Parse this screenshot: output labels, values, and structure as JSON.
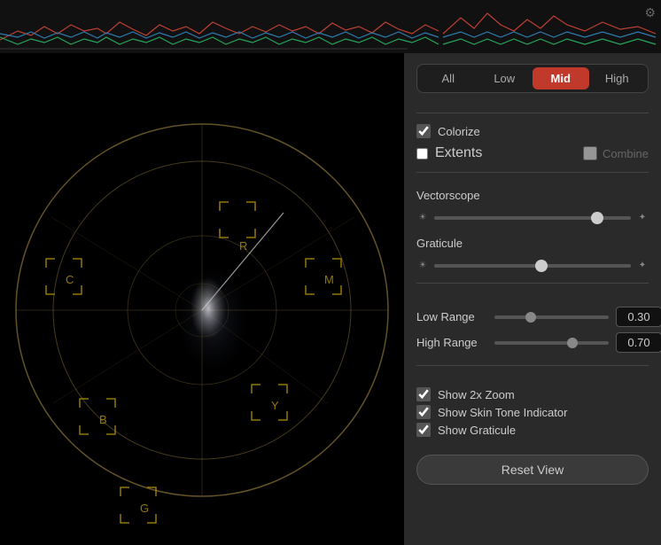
{
  "waveform": {
    "label": "Waveform Bar"
  },
  "tabs": {
    "items": [
      {
        "label": "All",
        "id": "all",
        "active": false
      },
      {
        "label": "Low",
        "id": "low",
        "active": false
      },
      {
        "label": "Mid",
        "id": "mid",
        "active": true
      },
      {
        "label": "High",
        "id": "high",
        "active": false
      }
    ]
  },
  "checkboxes": {
    "colorize": {
      "label": "Colorize",
      "checked": true
    },
    "extents": {
      "label": "Extents",
      "checked": false
    },
    "combine": {
      "label": "Combine",
      "checked": false
    }
  },
  "sliders": {
    "vectorscope_label": "Vectorscope",
    "graticule_label": "Graticule",
    "vectorscope_value": 85,
    "graticule_value": 55
  },
  "ranges": {
    "low_range": {
      "label": "Low Range",
      "value": "0.30",
      "slider_val": 30
    },
    "high_range": {
      "label": "High Range",
      "value": "0.70",
      "slider_val": 70
    }
  },
  "options": {
    "show_2x_zoom": {
      "label": "Show 2x Zoom",
      "checked": true
    },
    "show_skin_tone": {
      "label": "Show Skin Tone Indicator",
      "checked": true
    },
    "show_graticule": {
      "label": "Show Graticule",
      "checked": true
    }
  },
  "reset_button": {
    "label": "Reset View"
  },
  "scope": {
    "labels": [
      "R",
      "M",
      "Y",
      "B",
      "C",
      "G"
    ]
  }
}
